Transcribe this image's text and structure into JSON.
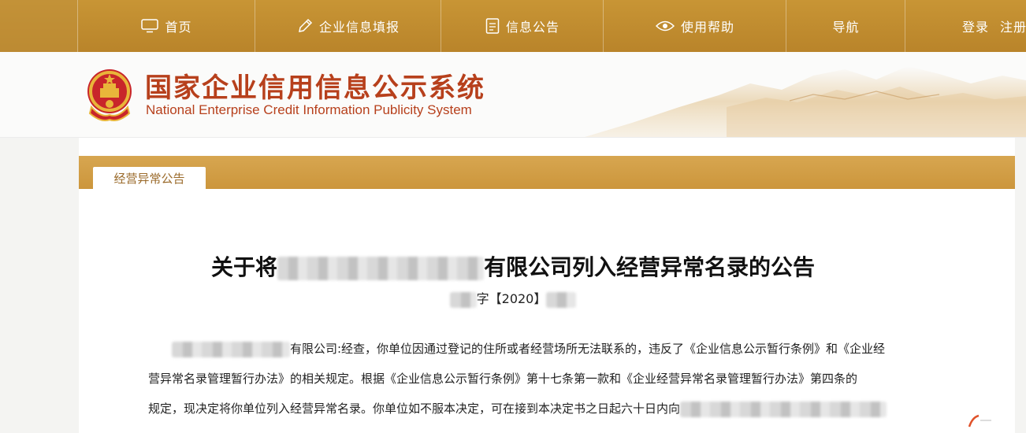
{
  "nav": {
    "home": "首页",
    "report": "企业信息填报",
    "notice": "信息公告",
    "help": "使用帮助",
    "guide": "导航",
    "login": "登录",
    "register": "注册"
  },
  "header": {
    "title": "国家企业信用信息公示系统",
    "subtitle": "National Enterprise Credit Information Publicity System"
  },
  "section": {
    "tab": "经营异常公告"
  },
  "doc": {
    "title_prefix": "关于将",
    "title_suffix": "有限公司列入经营异常名录的公告",
    "number_prefix": "字",
    "number_year": "【2020】",
    "p1": "有限公司:经查，你单位因通过登记的住所或者经营场所无法联系的，违反了《企业信息公示暂行条例》和《企业经",
    "p2": "营异常名录管理暂行办法》的相关规定。根据《企业信息公示暂行条例》第十七条第一款和《企业经营异常名录管理暂行办法》第四条的",
    "p3": "规定，现决定将你单位列入经营异常名录。你单位如不服本决定，可在接到本决定书之日起六十日内向"
  },
  "colors": {
    "nav_bg": "#c0903a",
    "title_red": "#b7401c",
    "band": "#d2a048"
  }
}
